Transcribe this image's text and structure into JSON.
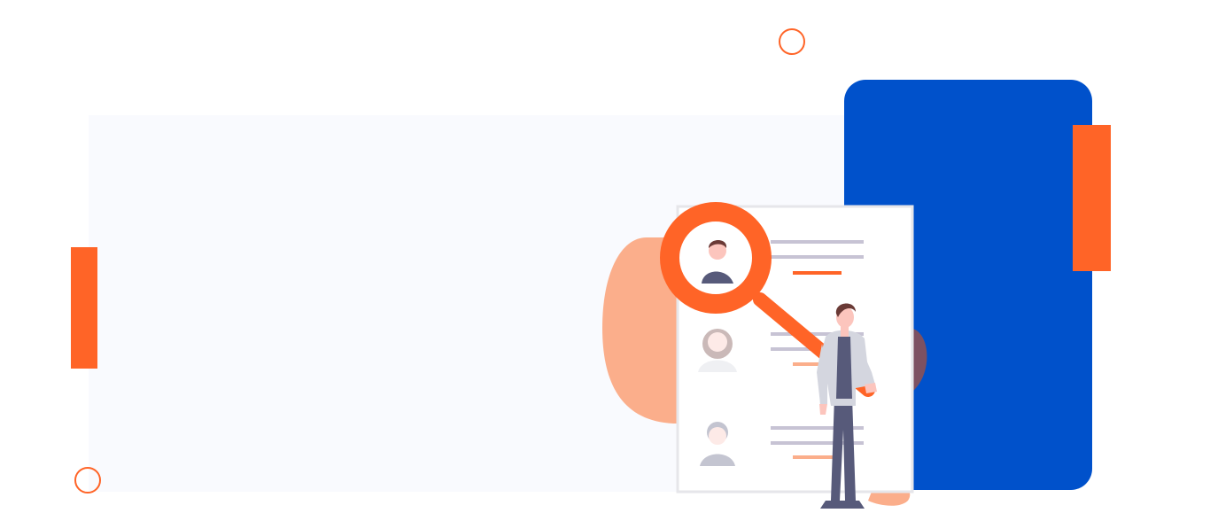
{
  "theme": {
    "accent": "#ff6427",
    "blue": "#0051cb",
    "panel": "#f9fafe",
    "blob": "#fbae8b",
    "blob_dark": "#7d5162",
    "paper": "#ffffff",
    "paper_border": "#e6e6ea",
    "line_gray": "#c7c3d4",
    "suit": "#d4d6df",
    "pants": "#575a7a",
    "skin": "#fcc5bd",
    "hair": "#6a3a36"
  },
  "icons": {
    "magnifier": "magnifying-glass-icon",
    "profile": "person-avatar-icon"
  }
}
